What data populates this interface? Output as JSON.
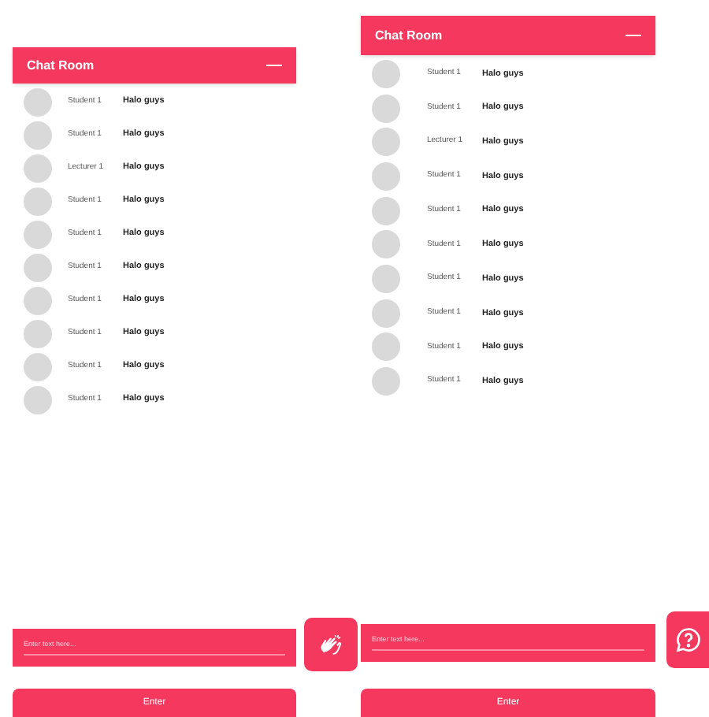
{
  "panels": [
    {
      "title": "Chat Room",
      "messages": [
        {
          "sender": "Student 1",
          "text": "Halo guys"
        },
        {
          "sender": "Student 1",
          "text": "Halo guys"
        },
        {
          "sender": "Lecturer 1",
          "text": "Halo guys"
        },
        {
          "sender": "Student 1",
          "text": "Halo guys"
        },
        {
          "sender": "Student 1",
          "text": "Halo guys"
        },
        {
          "sender": "Student 1",
          "text": "Halo guys"
        },
        {
          "sender": "Student 1",
          "text": "Halo guys"
        },
        {
          "sender": "Student 1",
          "text": "Halo guys"
        },
        {
          "sender": "Student 1",
          "text": "Halo guys"
        },
        {
          "sender": "Student 1",
          "text": "Halo guys"
        }
      ],
      "input": {
        "placeholder": "Enter text here..."
      },
      "button": "Enter"
    },
    {
      "title": "Chat Room",
      "messages": [
        {
          "sender": "Student 1",
          "text": "Halo guys"
        },
        {
          "sender": "Student 1",
          "text": "Halo guys"
        },
        {
          "sender": "Lecturer 1",
          "text": "Halo guys"
        },
        {
          "sender": "Student 1",
          "text": "Halo guys"
        },
        {
          "sender": "Student 1",
          "text": "Halo guys"
        },
        {
          "sender": "Student 1",
          "text": "Halo guys"
        },
        {
          "sender": "Student 1",
          "text": "Halo guys"
        },
        {
          "sender": "Student 1",
          "text": "Halo guys"
        },
        {
          "sender": "Student 1",
          "text": "Halo guys"
        },
        {
          "sender": "Student 1",
          "text": "Halo guys"
        }
      ],
      "input": {
        "placeholder": "Enter text here..."
      },
      "button": "Enter"
    }
  ],
  "side_buttons": [
    {
      "kind": "clap"
    },
    {
      "kind": "help"
    }
  ]
}
